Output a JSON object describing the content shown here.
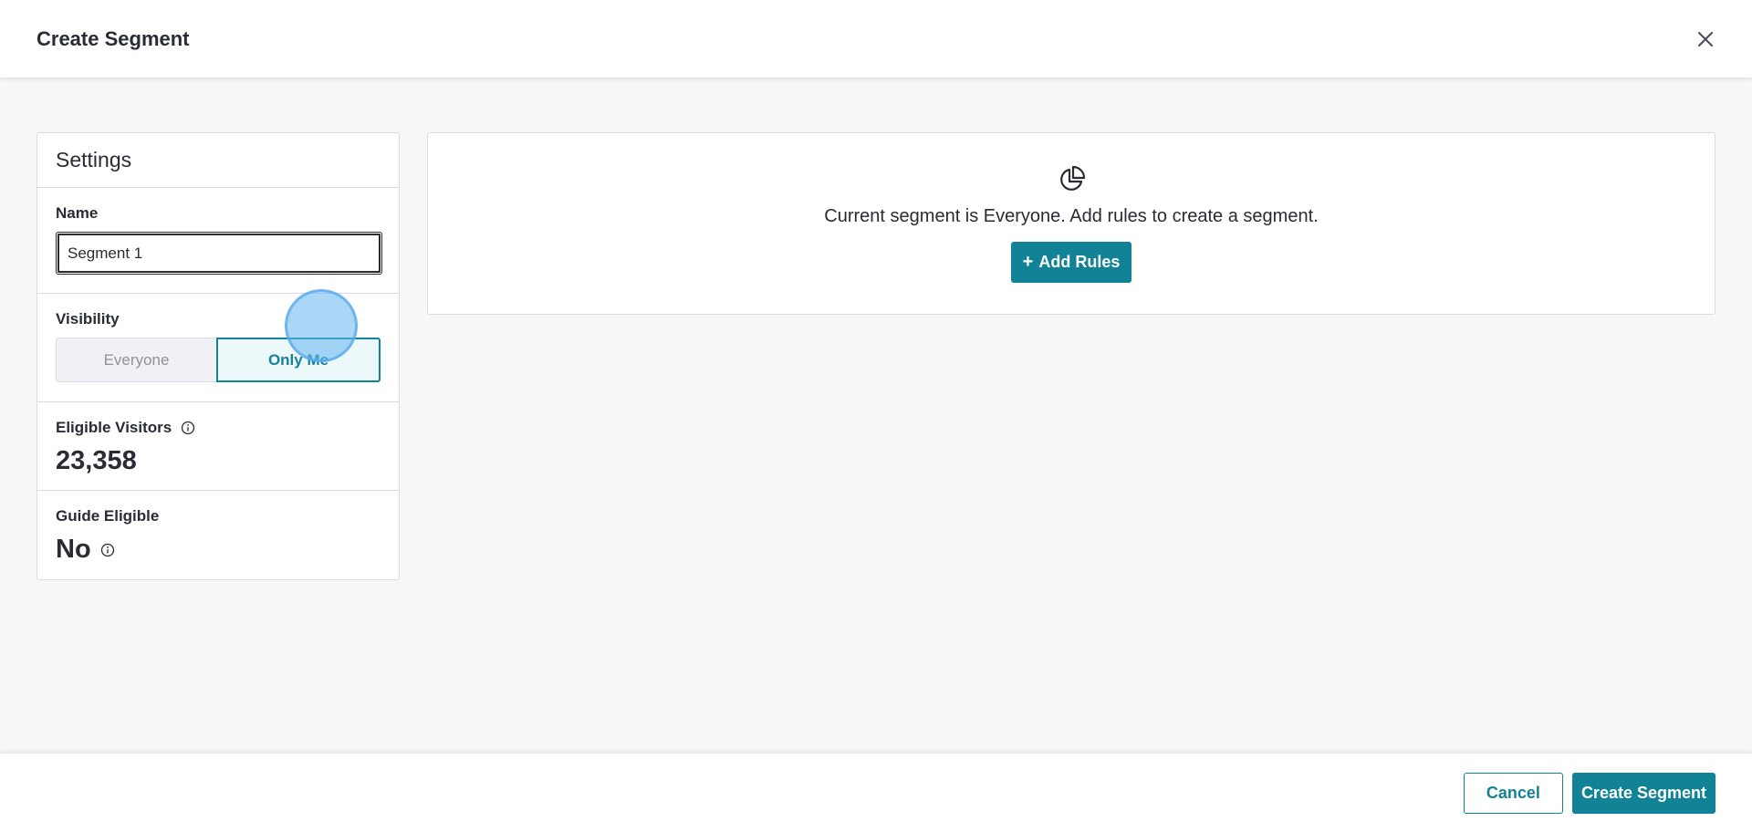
{
  "header": {
    "title": "Create Segment",
    "close_icon": "close-icon"
  },
  "settings": {
    "title": "Settings",
    "name": {
      "label": "Name",
      "value": "Segment 1"
    },
    "visibility": {
      "label": "Visibility",
      "options": [
        "Everyone",
        "Only Me"
      ],
      "selected": "Only Me"
    },
    "eligible_visitors": {
      "label": "Eligible Visitors",
      "value": "23,358",
      "icon": "info-icon"
    },
    "guide_eligible": {
      "label": "Guide Eligible",
      "value": "No",
      "icon": "info-icon"
    }
  },
  "rules": {
    "icon": "pie-chart-icon",
    "message": "Current segment is Everyone. Add rules to create a segment.",
    "add_label": "Add Rules"
  },
  "footer": {
    "cancel_label": "Cancel",
    "create_label": "Create Segment"
  },
  "colors": {
    "accent": "#128297",
    "text": "#2a2c35",
    "border": "#dadce5",
    "background": "#f7f7f7"
  }
}
